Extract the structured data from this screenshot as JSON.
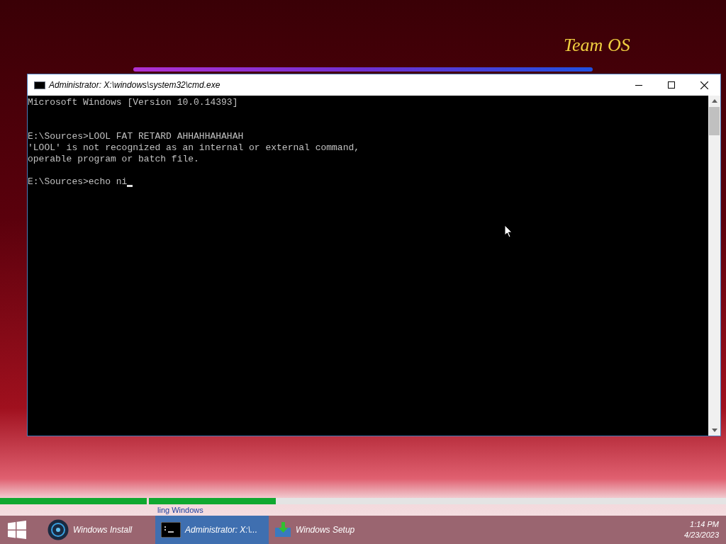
{
  "desktop": {
    "brand": "Team OS"
  },
  "console_window": {
    "title": "Administrator: X:\\windows\\system32\\cmd.exe",
    "lines": [
      {
        "text": "Microsoft Windows [Version 10.0.14393]",
        "cursor": false
      },
      {
        "text": "E:\\Sources>LOOL FAT RETARD AHHAHHAHAHAH",
        "cursor": false
      },
      {
        "text": "'LOOL' is not recognized as an internal or external command,",
        "cursor": false
      },
      {
        "text": "operable program or batch file.",
        "cursor": false
      },
      {
        "text": "E:\\Sources>echo ni",
        "cursor": true
      }
    ]
  },
  "progress": [
    {
      "level": 1
    },
    {
      "level": 0.22
    }
  ],
  "status_text": "ling Windows",
  "taskbar": {
    "items": [
      {
        "label": "Windows Install",
        "kind": "disc",
        "selected": false
      },
      {
        "label": "Administrator: X:\\...",
        "kind": "console",
        "selected": true
      },
      {
        "label": "Windows Setup",
        "kind": "setup",
        "selected": false
      }
    ],
    "clock": {
      "time": "1:14 PM",
      "date": "4/23/2023"
    }
  }
}
